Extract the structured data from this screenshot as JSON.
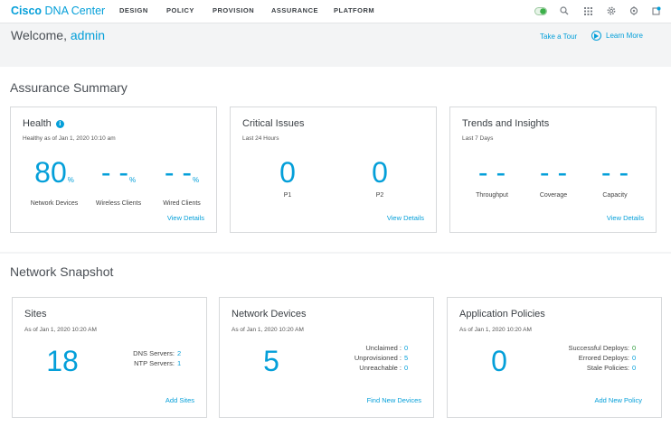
{
  "app": {
    "brand_bold": "Cisco",
    "brand_rest": " DNA Center"
  },
  "nav": [
    "DESIGN",
    "POLICY",
    "PROVISION",
    "ASSURANCE",
    "PLATFORM"
  ],
  "header": {
    "welcome": "Welcome,",
    "user": "admin",
    "tour": "Take a Tour",
    "learn_more": "Learn More"
  },
  "assurance": {
    "title": "Assurance Summary",
    "health": {
      "title": "Health",
      "subtitle": "Healthy as of Jan 1, 2020 10:10 am",
      "metrics": [
        {
          "value": "80",
          "unit": "%",
          "label": "Network Devices"
        },
        {
          "value": "- -",
          "unit": "%",
          "label": "Wireless Clients"
        },
        {
          "value": "- -",
          "unit": "%",
          "label": "Wired Clients"
        }
      ],
      "link": "View Details"
    },
    "issues": {
      "title": "Critical Issues",
      "subtitle": "Last 24 Hours",
      "metrics": [
        {
          "value": "0",
          "label": "P1"
        },
        {
          "value": "0",
          "label": "P2"
        }
      ],
      "link": "View Details"
    },
    "trends": {
      "title": "Trends and Insights",
      "subtitle": "Last 7 Days",
      "metrics": [
        {
          "value": "- -",
          "label": "Throughput"
        },
        {
          "value": "- -",
          "label": "Coverage"
        },
        {
          "value": "- -",
          "label": "Capacity"
        }
      ],
      "link": "View Details"
    }
  },
  "snapshot": {
    "title": "Network Snapshot",
    "sites": {
      "title": "Sites",
      "subtitle": "As of Jan 1, 2020 10:20 AM",
      "value": "18",
      "details": [
        {
          "label": "DNS Servers:",
          "value": "2"
        },
        {
          "label": "NTP Servers:",
          "value": "1"
        }
      ],
      "link": "Add Sites"
    },
    "devices": {
      "title": "Network Devices",
      "subtitle": "As of Jan 1, 2020 10:20 AM",
      "value": "5",
      "details": [
        {
          "label": "Unclaimed :",
          "value": "0"
        },
        {
          "label": "Unprovisioned :",
          "value": "5"
        },
        {
          "label": "Unreachable :",
          "value": "0"
        }
      ],
      "link": "Find New Devices"
    },
    "policies": {
      "title": "Application Policies",
      "subtitle": "As of Jan 1, 2020 10:20 AM",
      "value": "0",
      "details": [
        {
          "label": "Successful Deploys:",
          "value": "0"
        },
        {
          "label": "Errored Deploys:",
          "value": "0"
        },
        {
          "label": "Stale Policies:",
          "value": "0"
        }
      ],
      "link": "Add New Policy"
    }
  },
  "colors": {
    "accent": "#049fd9",
    "success": "#2e9c3b"
  },
  "icons": [
    "toggle-icon",
    "search-icon",
    "apps-grid-icon",
    "gear-icon",
    "settings-icon",
    "notifications-icon"
  ]
}
